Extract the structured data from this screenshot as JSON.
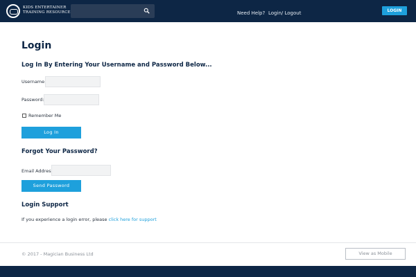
{
  "header": {
    "brand_line1": "KIDS ENTERTAINER",
    "brand_line2": "TRAINING RESOURCE",
    "search_icon": "search-icon",
    "nav_help": "Need Help?",
    "nav_login": "Login/ Logout",
    "login_button": "LOGIN"
  },
  "page": {
    "title": "Login",
    "subtitle": "Log In By Entering Your Username and Password Below...",
    "username_label": "Username:",
    "password_label": "Password:",
    "remember_label": "Remember Me",
    "login_button": "Log In",
    "forgot_title": "Forgot Your Password?",
    "email_label": "Email Address:",
    "send_button": "Send Password",
    "support_title": "Login Support",
    "support_text": "If you experience a login error, please ",
    "support_link": "click here for support"
  },
  "footer": {
    "copyright": "© 2017 - Magician Business Ltd",
    "mobile_button": "View as Mobile"
  },
  "colors": {
    "navy": "#0d2645",
    "accent": "#1ea0dc"
  }
}
